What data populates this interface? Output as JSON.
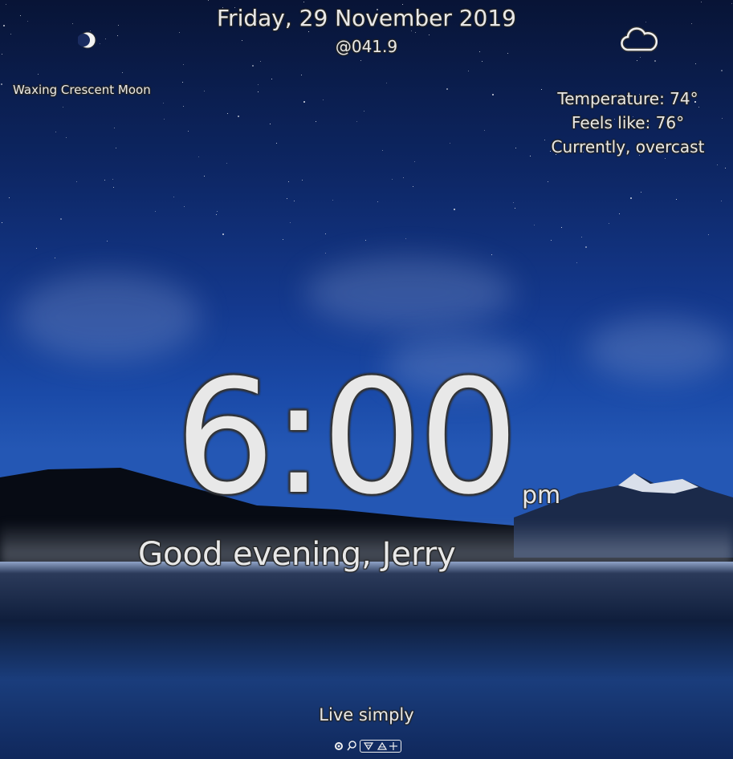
{
  "header": {
    "date": "Friday, 29 November 2019",
    "beat_time": "@041.9"
  },
  "moon": {
    "icon": "crescent-moon-icon",
    "phase": "Waxing Crescent Moon"
  },
  "weather": {
    "icon": "cloud-icon",
    "temperature": "Temperature: 74°",
    "feels_like": "Feels like: 76°",
    "condition": "Currently, overcast"
  },
  "clock": {
    "time": "6:00",
    "meridiem": "pm"
  },
  "greeting": "Good evening, Jerry",
  "quote": "Live simply",
  "toolbar": {
    "items": [
      "settings-icon",
      "search-icon",
      "alchemy-icons"
    ],
    "alchemy_glyphs": "🜄🜂🜃"
  },
  "colors": {
    "text": "#e8e8e8",
    "sky_top": "#081436",
    "sky_bottom": "#2457b4"
  }
}
